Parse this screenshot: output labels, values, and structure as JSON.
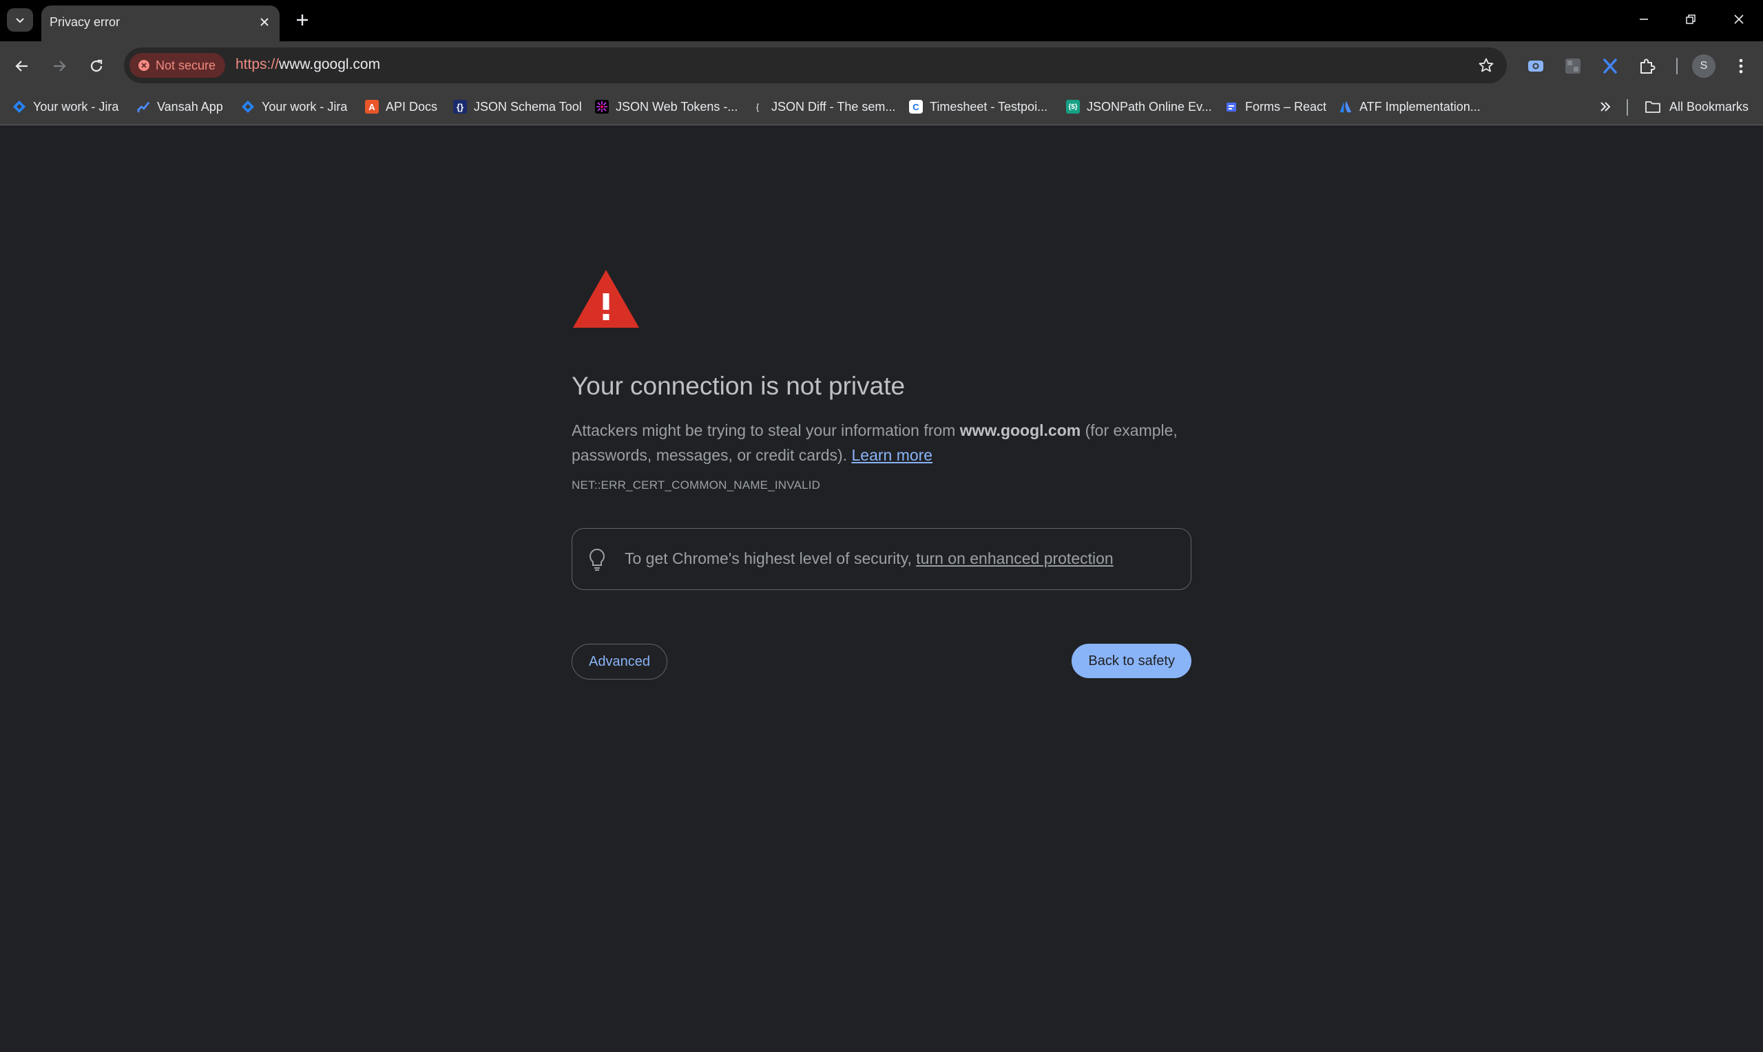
{
  "tab": {
    "title": "Privacy error"
  },
  "omnibox": {
    "security_chip": "Not secure",
    "url_scheme": "https://",
    "url_host": "www.googl.com"
  },
  "profile": {
    "initial": "S"
  },
  "bookmarks": {
    "items": [
      {
        "label": "Your work - Jira",
        "icon": "jira-icon"
      },
      {
        "label": "Vansah App",
        "icon": "vansah-icon"
      },
      {
        "label": "Your work - Jira",
        "icon": "jira-icon"
      },
      {
        "label": "API Docs",
        "icon": "api-docs-icon"
      },
      {
        "label": "JSON Schema Tool",
        "icon": "json-schema-icon"
      },
      {
        "label": "JSON Web Tokens -...",
        "icon": "jwt-icon"
      },
      {
        "label": "JSON Diff - The sem...",
        "icon": "json-diff-icon"
      },
      {
        "label": "Timesheet - Testpoi...",
        "icon": "timesheet-icon"
      },
      {
        "label": "JSONPath Online Ev...",
        "icon": "jsonpath-icon"
      },
      {
        "label": "Forms – React",
        "icon": "react-forms-icon"
      },
      {
        "label": "ATF Implementation...",
        "icon": "atlassian-icon"
      }
    ],
    "all_bookmarks": "All Bookmarks"
  },
  "interstitial": {
    "heading": "Your connection is not private",
    "explain_prefix": "Attackers might be trying to steal your information from ",
    "explain_host": "www.googl.com",
    "explain_suffix": " (for example, passwords, messages, or credit cards). ",
    "learn_more": "Learn more",
    "error_code": "NET::ERR_CERT_COMMON_NAME_INVALID",
    "enhanced_prefix": "To get Chrome's highest level of security, ",
    "enhanced_link": "turn on enhanced protection",
    "advanced_button": "Advanced",
    "back_button": "Back to safety"
  },
  "colors": {
    "background": "#202124",
    "warning_red": "#d93025",
    "link_blue": "#8ab4f8",
    "not_secure_red": "#f28b82"
  }
}
